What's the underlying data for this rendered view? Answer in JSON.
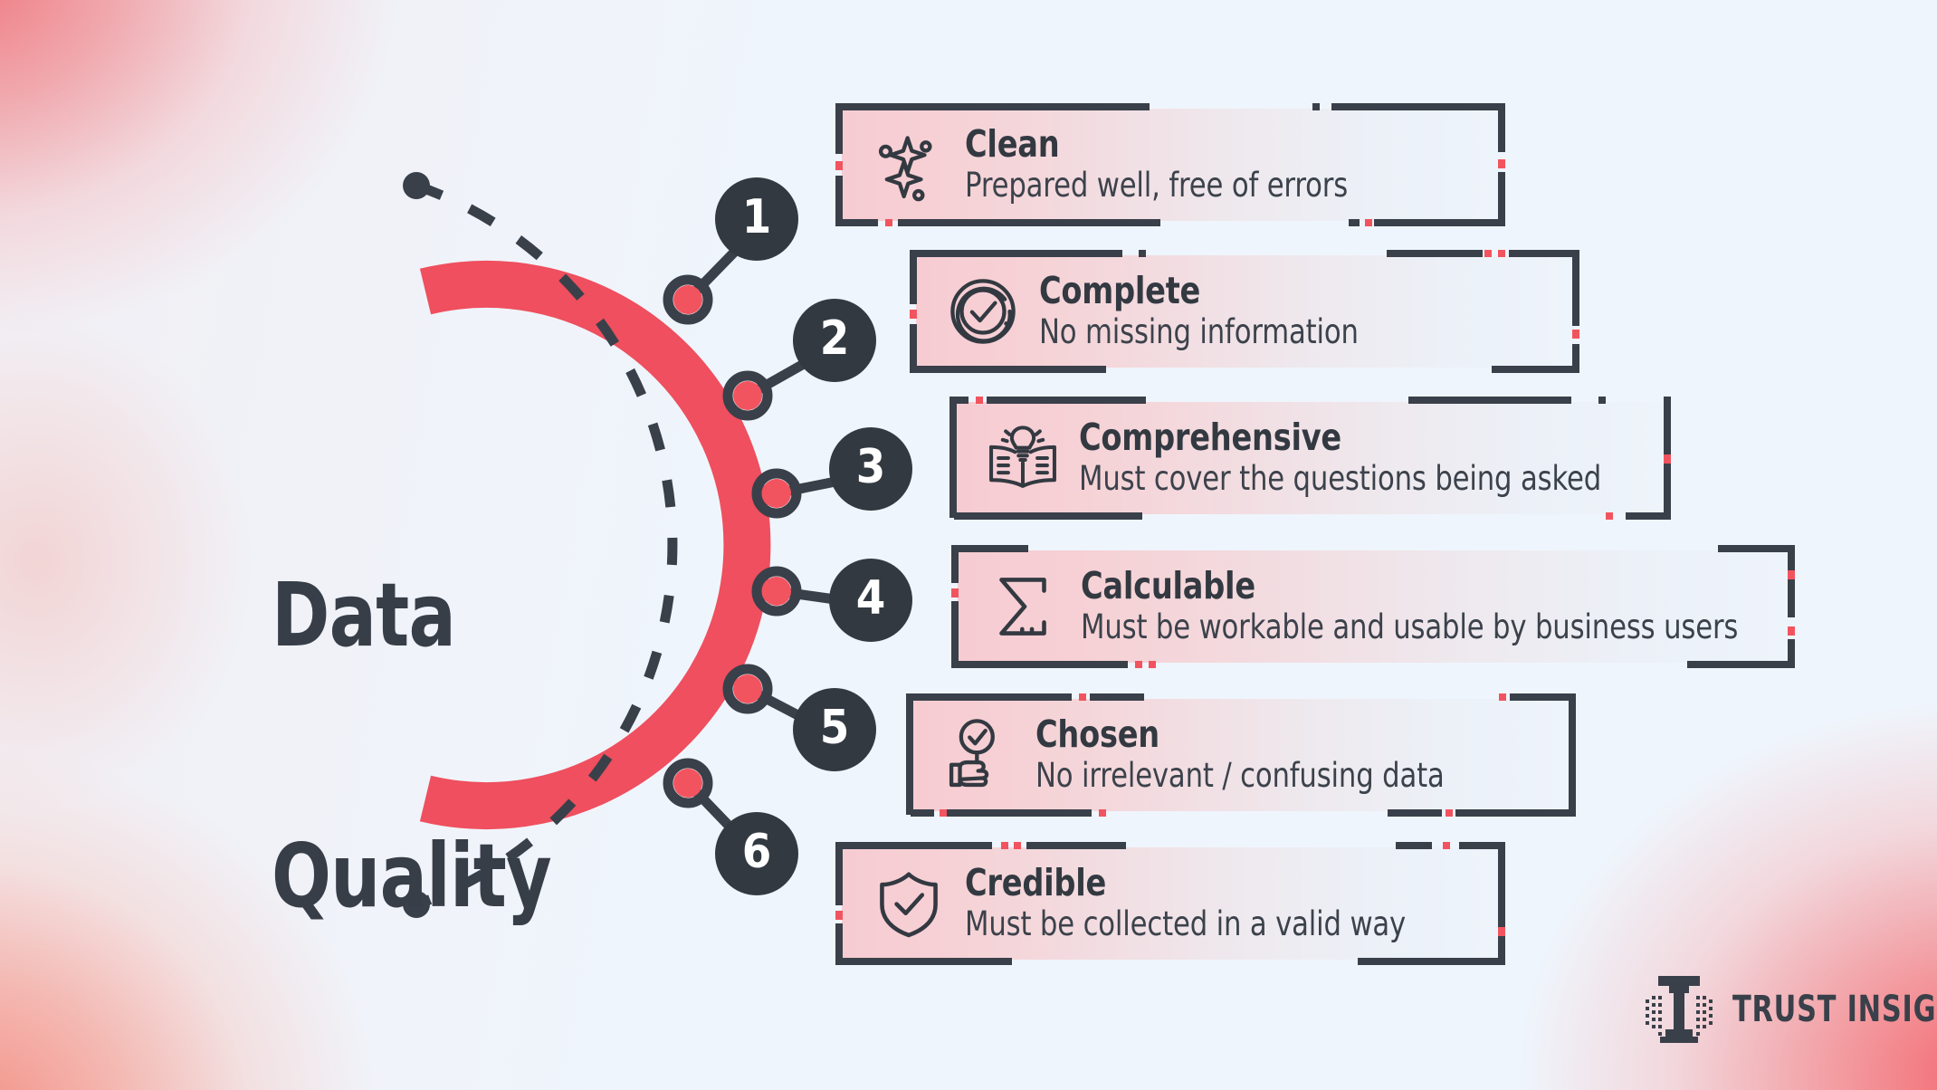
{
  "theme": {
    "accent_red": "#f2545f",
    "arc_red": "#ef4f5e",
    "ink": "#333941",
    "ink_soft": "#3c424b",
    "bg": "#eff5fc",
    "card_pink": "#f6ccd2"
  },
  "headline": {
    "line1": "Data",
    "line2": "Quality"
  },
  "items": [
    {
      "number": "1",
      "title": "Clean",
      "desc": "Prepared well, free of errors",
      "icon": "sparkles-icon"
    },
    {
      "number": "2",
      "title": "Complete",
      "desc": "No missing information",
      "icon": "check-circle-icon"
    },
    {
      "number": "3",
      "title": "Comprehensive",
      "desc": "Must cover the questions being asked",
      "icon": "open-book-lightbulb-icon"
    },
    {
      "number": "4",
      "title": "Calculable",
      "desc": "Must be workable and usable by business users",
      "icon": "sigma-sum-icon"
    },
    {
      "number": "5",
      "title": "Chosen",
      "desc": "No irrelevant / confusing data",
      "icon": "magnifier-check-hand-icon"
    },
    {
      "number": "6",
      "title": "Credible",
      "desc": "Must be collected in a valid way",
      "icon": "shield-check-icon"
    }
  ],
  "brand": {
    "name": "TRUST INSIGHTS",
    "mark": "trust-insights-t-monogram"
  }
}
